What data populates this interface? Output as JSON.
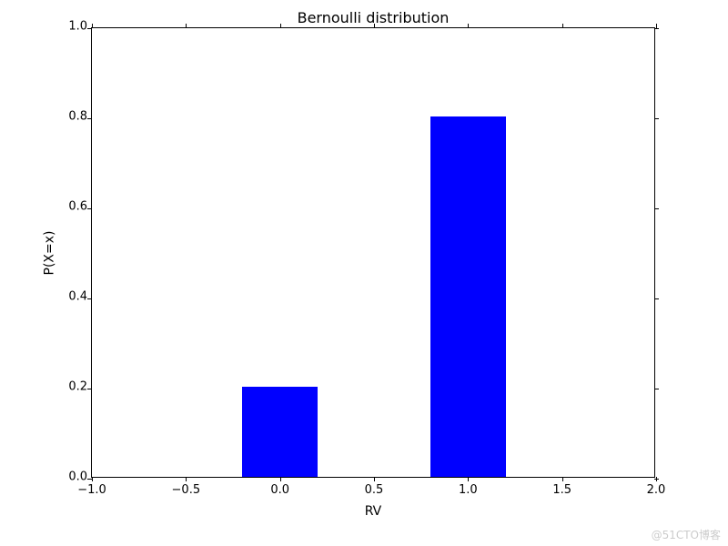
{
  "chart_data": {
    "type": "bar",
    "title": "Bernoulli distribution",
    "xlabel": "RV",
    "ylabel": "P(X=x)",
    "xlim": [
      -1.0,
      2.0
    ],
    "ylim": [
      0.0,
      1.0
    ],
    "xticks": [
      -1.0,
      -0.5,
      0.0,
      0.5,
      1.0,
      1.5,
      2.0
    ],
    "yticks": [
      0.0,
      0.2,
      0.4,
      0.6,
      0.8,
      1.0
    ],
    "categories": [
      0,
      1
    ],
    "values": [
      0.2,
      0.8
    ],
    "bar_width": 0.4,
    "bar_color": "#0000ff"
  },
  "watermark": "@51CTO博客",
  "xtick_labels": [
    "−1.0",
    "−0.5",
    "0.0",
    "0.5",
    "1.0",
    "1.5",
    "2.0"
  ],
  "ytick_labels": [
    "0.0",
    "0.2",
    "0.4",
    "0.6",
    "0.8",
    "1.0"
  ]
}
